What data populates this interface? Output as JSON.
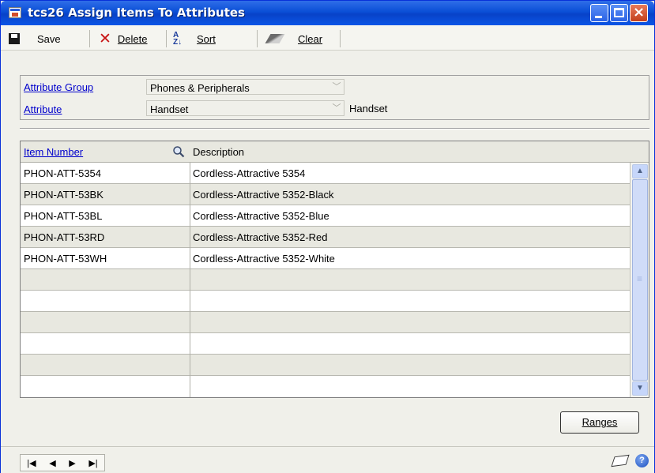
{
  "window": {
    "title": "tcs26 Assign Items To Attributes"
  },
  "toolbar": {
    "save": "Save",
    "delete": "Delete",
    "sort": "Sort",
    "clear": "Clear"
  },
  "form": {
    "attribute_group_label": "Attribute Group",
    "attribute_group_value": "Phones & Peripherals",
    "attribute_label": "Attribute",
    "attribute_value": "Handset",
    "attribute_description": "Handset"
  },
  "grid": {
    "columns": [
      "Item Number",
      "Description"
    ],
    "rows": [
      {
        "item": "PHON-ATT-5354",
        "desc": "Cordless-Attractive 5354"
      },
      {
        "item": "PHON-ATT-53BK",
        "desc": "Cordless-Attractive 5352-Black"
      },
      {
        "item": "PHON-ATT-53BL",
        "desc": "Cordless-Attractive 5352-Blue"
      },
      {
        "item": "PHON-ATT-53RD",
        "desc": "Cordless-Attractive 5352-Red"
      },
      {
        "item": "PHON-ATT-53WH",
        "desc": "Cordless-Attractive 5352-White"
      },
      {
        "item": "",
        "desc": ""
      },
      {
        "item": "",
        "desc": ""
      },
      {
        "item": "",
        "desc": ""
      },
      {
        "item": "",
        "desc": ""
      },
      {
        "item": "",
        "desc": ""
      },
      {
        "item": "",
        "desc": ""
      }
    ]
  },
  "buttons": {
    "ranges": "Ranges"
  },
  "icons": {
    "window": "window-icon",
    "save": "save-icon",
    "delete": "delete-icon",
    "sort": "sort-icon",
    "clear": "clear-icon",
    "lookup": "lookup-icon",
    "note": "note-icon",
    "help": "help-icon"
  }
}
